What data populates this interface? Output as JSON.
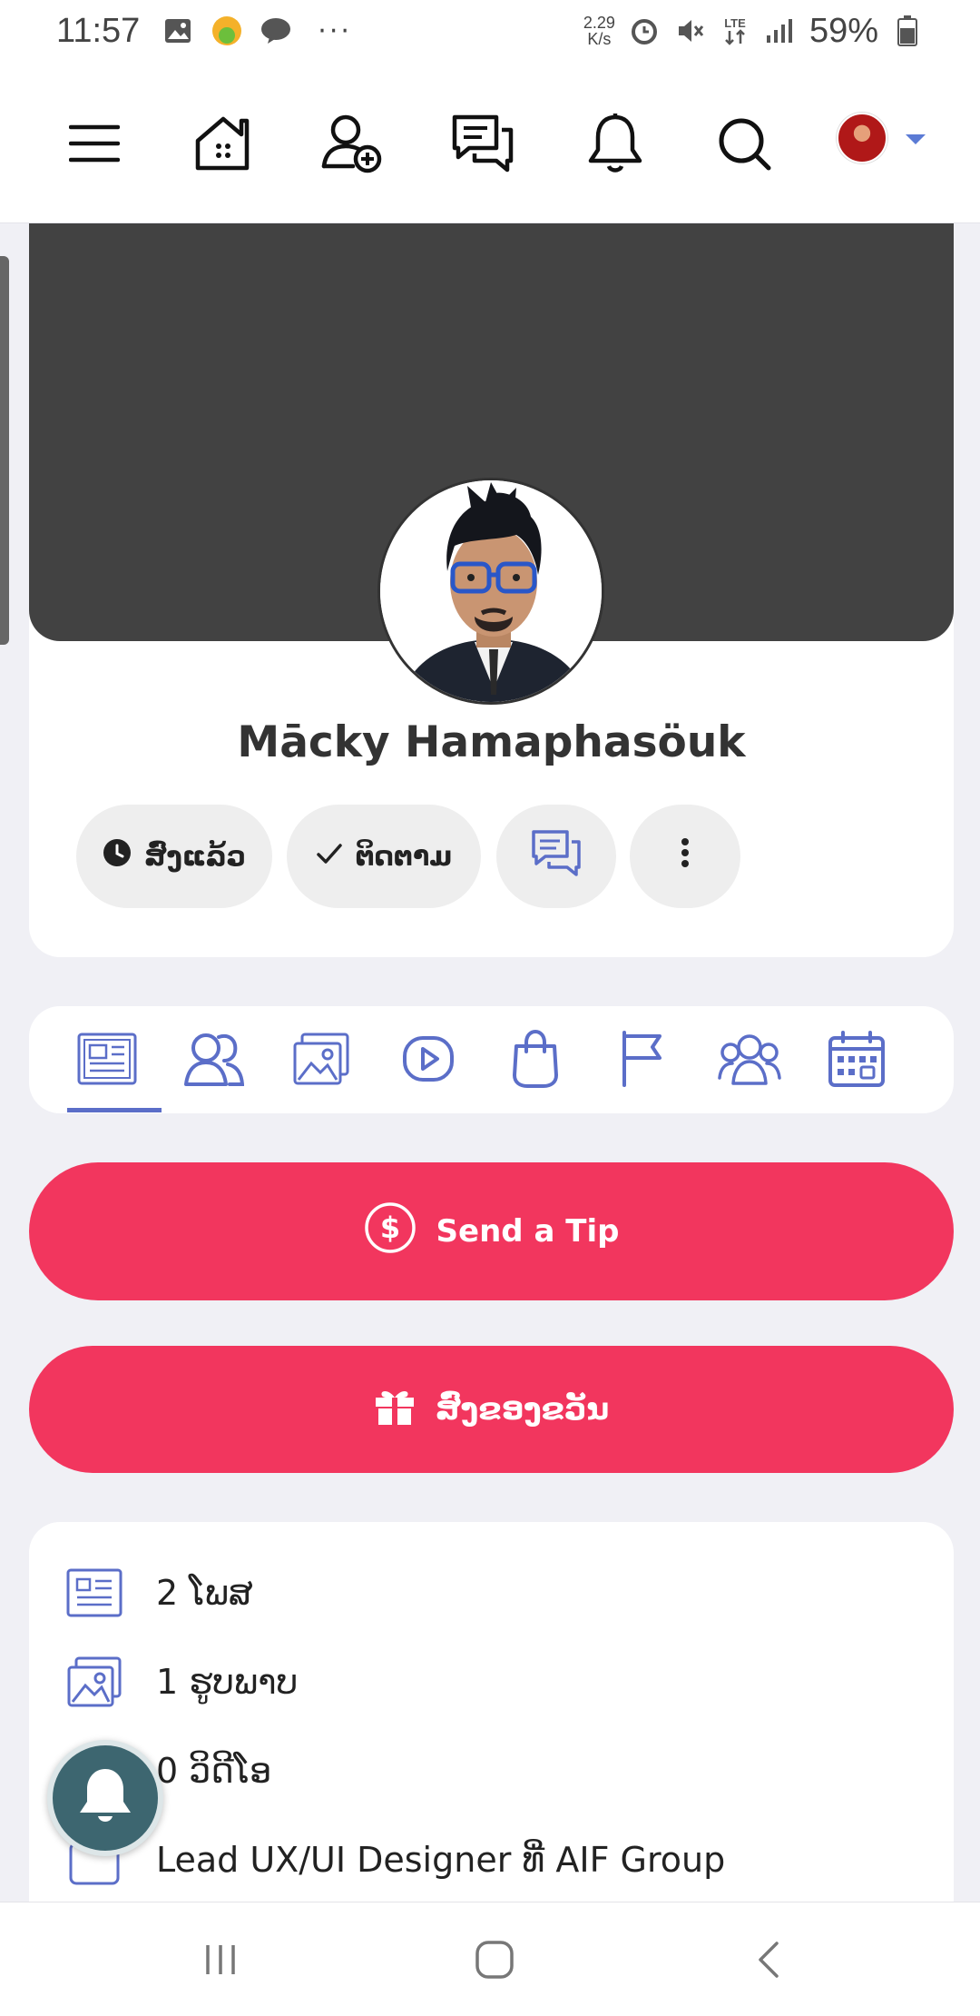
{
  "status_bar": {
    "time": "11:57",
    "notification_icons": [
      "gallery-icon",
      "yes-app-icon",
      "line-app-icon"
    ],
    "more": "···",
    "speed_value": "2.29",
    "speed_unit": "K/s",
    "network": "LTE",
    "battery": "59%"
  },
  "top_nav": {
    "items": [
      "menu-icon",
      "home-icon",
      "add-friend-icon",
      "messages-icon",
      "notifications-icon",
      "search-icon",
      "avatar"
    ]
  },
  "profile": {
    "name": "Mācky Hamaphasöuk",
    "actions": {
      "sent_label": "ສົ່ງແລ້ວ",
      "follow_label": "ຕິດຕາມ"
    }
  },
  "tabs": {
    "items": [
      "posts-icon",
      "friends-icon",
      "photos-icon",
      "videos-icon",
      "shop-icon",
      "pages-icon",
      "groups-icon",
      "events-icon"
    ],
    "active": "posts-icon"
  },
  "buttons": {
    "tip_label": "Send a Tip",
    "gift_label": "ສົ່ງຂອງຂວັນ"
  },
  "info": {
    "posts_count": "2",
    "posts_label": "ໂພສ",
    "photos_count": "1",
    "photos_label": "ຮູບພາບ",
    "videos_count": "0",
    "videos_label": "ວິດີໂອ",
    "job": "Lead UX/UI Designer ທີ່ AIF Group"
  },
  "colors": {
    "accent": "#f2365e",
    "icon_blue": "#5b6ec8",
    "cover": "#424242",
    "page_bg": "#f0f0f5"
  }
}
